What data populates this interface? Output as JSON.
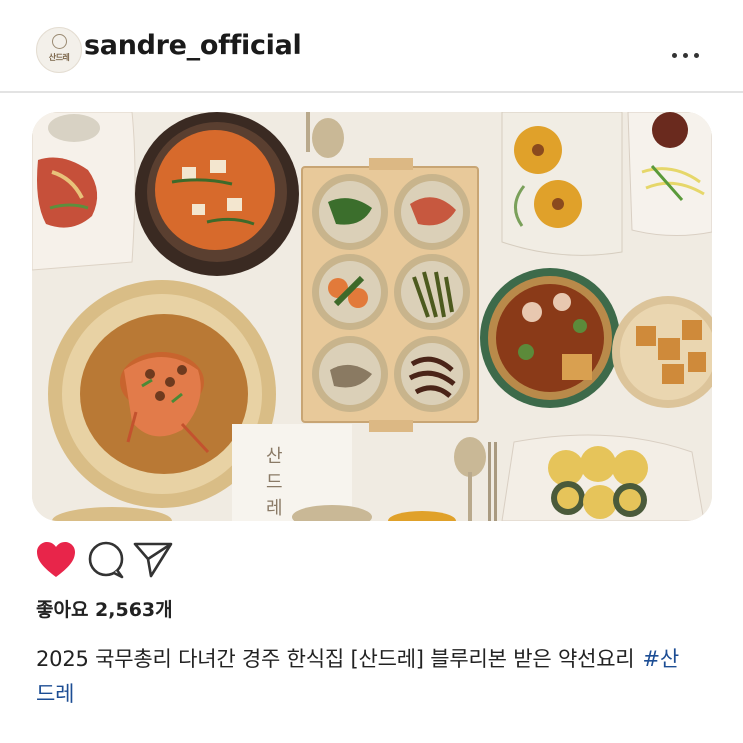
{
  "post": {
    "account": {
      "username": "sandre_official",
      "avatar_label": "산드레"
    },
    "menu_icon": "more-horizontal-icon",
    "photo": {
      "alt": "Korean table spread with soup, braised shrimp, banchan and fried vegetables",
      "watermark": "산드레"
    },
    "actions": {
      "like_icon": "heart-filled-icon",
      "comment_icon": "comment-bubble-icon",
      "share_icon": "paper-plane-icon",
      "liked": true
    },
    "likes_text": "좋아요 2,563개",
    "caption": {
      "text": "2025 국무총리 다녀간 경주 한식집 [산드레] 블루리본 받은 약선요리",
      "hashtag": "#산드레"
    }
  },
  "colors": {
    "like_red": "#e8254a",
    "hashtag_blue": "#1c4d94",
    "text": "#222222",
    "divider": "#e3e3e3"
  }
}
